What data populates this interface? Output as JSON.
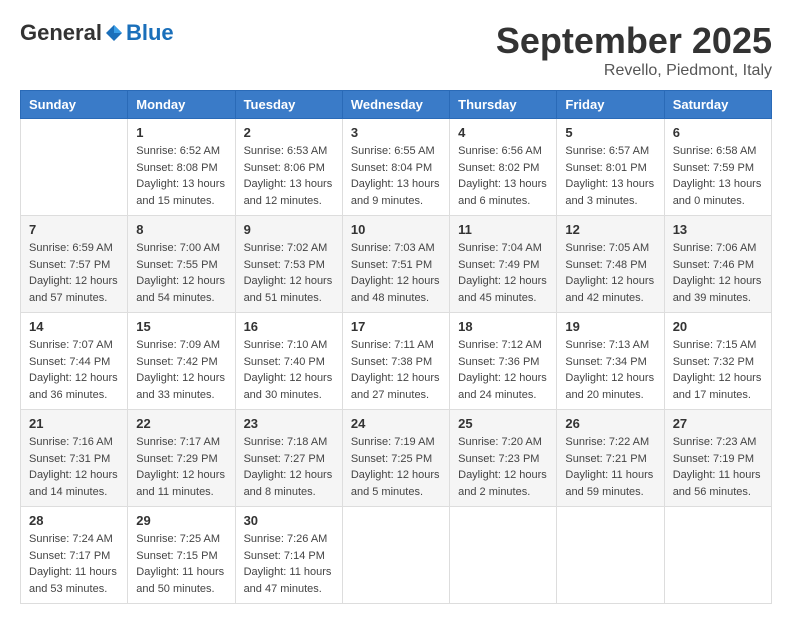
{
  "header": {
    "logo_general": "General",
    "logo_blue": "Blue",
    "month_title": "September 2025",
    "location": "Revello, Piedmont, Italy"
  },
  "days_of_week": [
    "Sunday",
    "Monday",
    "Tuesday",
    "Wednesday",
    "Thursday",
    "Friday",
    "Saturday"
  ],
  "weeks": [
    [
      {
        "day": "",
        "info": ""
      },
      {
        "day": "1",
        "info": "Sunrise: 6:52 AM\nSunset: 8:08 PM\nDaylight: 13 hours\nand 15 minutes."
      },
      {
        "day": "2",
        "info": "Sunrise: 6:53 AM\nSunset: 8:06 PM\nDaylight: 13 hours\nand 12 minutes."
      },
      {
        "day": "3",
        "info": "Sunrise: 6:55 AM\nSunset: 8:04 PM\nDaylight: 13 hours\nand 9 minutes."
      },
      {
        "day": "4",
        "info": "Sunrise: 6:56 AM\nSunset: 8:02 PM\nDaylight: 13 hours\nand 6 minutes."
      },
      {
        "day": "5",
        "info": "Sunrise: 6:57 AM\nSunset: 8:01 PM\nDaylight: 13 hours\nand 3 minutes."
      },
      {
        "day": "6",
        "info": "Sunrise: 6:58 AM\nSunset: 7:59 PM\nDaylight: 13 hours\nand 0 minutes."
      }
    ],
    [
      {
        "day": "7",
        "info": "Sunrise: 6:59 AM\nSunset: 7:57 PM\nDaylight: 12 hours\nand 57 minutes."
      },
      {
        "day": "8",
        "info": "Sunrise: 7:00 AM\nSunset: 7:55 PM\nDaylight: 12 hours\nand 54 minutes."
      },
      {
        "day": "9",
        "info": "Sunrise: 7:02 AM\nSunset: 7:53 PM\nDaylight: 12 hours\nand 51 minutes."
      },
      {
        "day": "10",
        "info": "Sunrise: 7:03 AM\nSunset: 7:51 PM\nDaylight: 12 hours\nand 48 minutes."
      },
      {
        "day": "11",
        "info": "Sunrise: 7:04 AM\nSunset: 7:49 PM\nDaylight: 12 hours\nand 45 minutes."
      },
      {
        "day": "12",
        "info": "Sunrise: 7:05 AM\nSunset: 7:48 PM\nDaylight: 12 hours\nand 42 minutes."
      },
      {
        "day": "13",
        "info": "Sunrise: 7:06 AM\nSunset: 7:46 PM\nDaylight: 12 hours\nand 39 minutes."
      }
    ],
    [
      {
        "day": "14",
        "info": "Sunrise: 7:07 AM\nSunset: 7:44 PM\nDaylight: 12 hours\nand 36 minutes."
      },
      {
        "day": "15",
        "info": "Sunrise: 7:09 AM\nSunset: 7:42 PM\nDaylight: 12 hours\nand 33 minutes."
      },
      {
        "day": "16",
        "info": "Sunrise: 7:10 AM\nSunset: 7:40 PM\nDaylight: 12 hours\nand 30 minutes."
      },
      {
        "day": "17",
        "info": "Sunrise: 7:11 AM\nSunset: 7:38 PM\nDaylight: 12 hours\nand 27 minutes."
      },
      {
        "day": "18",
        "info": "Sunrise: 7:12 AM\nSunset: 7:36 PM\nDaylight: 12 hours\nand 24 minutes."
      },
      {
        "day": "19",
        "info": "Sunrise: 7:13 AM\nSunset: 7:34 PM\nDaylight: 12 hours\nand 20 minutes."
      },
      {
        "day": "20",
        "info": "Sunrise: 7:15 AM\nSunset: 7:32 PM\nDaylight: 12 hours\nand 17 minutes."
      }
    ],
    [
      {
        "day": "21",
        "info": "Sunrise: 7:16 AM\nSunset: 7:31 PM\nDaylight: 12 hours\nand 14 minutes."
      },
      {
        "day": "22",
        "info": "Sunrise: 7:17 AM\nSunset: 7:29 PM\nDaylight: 12 hours\nand 11 minutes."
      },
      {
        "day": "23",
        "info": "Sunrise: 7:18 AM\nSunset: 7:27 PM\nDaylight: 12 hours\nand 8 minutes."
      },
      {
        "day": "24",
        "info": "Sunrise: 7:19 AM\nSunset: 7:25 PM\nDaylight: 12 hours\nand 5 minutes."
      },
      {
        "day": "25",
        "info": "Sunrise: 7:20 AM\nSunset: 7:23 PM\nDaylight: 12 hours\nand 2 minutes."
      },
      {
        "day": "26",
        "info": "Sunrise: 7:22 AM\nSunset: 7:21 PM\nDaylight: 11 hours\nand 59 minutes."
      },
      {
        "day": "27",
        "info": "Sunrise: 7:23 AM\nSunset: 7:19 PM\nDaylight: 11 hours\nand 56 minutes."
      }
    ],
    [
      {
        "day": "28",
        "info": "Sunrise: 7:24 AM\nSunset: 7:17 PM\nDaylight: 11 hours\nand 53 minutes."
      },
      {
        "day": "29",
        "info": "Sunrise: 7:25 AM\nSunset: 7:15 PM\nDaylight: 11 hours\nand 50 minutes."
      },
      {
        "day": "30",
        "info": "Sunrise: 7:26 AM\nSunset: 7:14 PM\nDaylight: 11 hours\nand 47 minutes."
      },
      {
        "day": "",
        "info": ""
      },
      {
        "day": "",
        "info": ""
      },
      {
        "day": "",
        "info": ""
      },
      {
        "day": "",
        "info": ""
      }
    ]
  ]
}
